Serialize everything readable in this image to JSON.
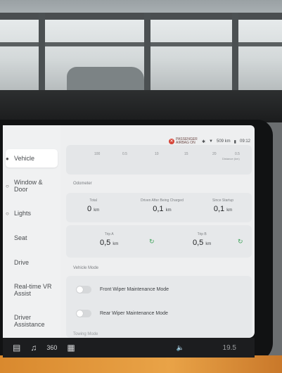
{
  "sidebar": {
    "items": [
      {
        "label": "Vehicle"
      },
      {
        "label": "Window & Door"
      },
      {
        "label": "Lights"
      },
      {
        "label": "Seat"
      },
      {
        "label": "Drive"
      },
      {
        "label": "Real-time VR Assist"
      },
      {
        "label": "Driver Assistance"
      }
    ]
  },
  "status": {
    "airbag_text": "PASSENGER AIRBAG ON",
    "range": "509 km",
    "time": "09:12"
  },
  "scale": {
    "ticks": [
      "100",
      "0.5",
      "10",
      "15",
      "20",
      "0.5"
    ],
    "caption": "Distance (km)"
  },
  "odometer": {
    "section_label": "Odometer",
    "total_label": "Total",
    "total_value": "0",
    "after_charge_label": "Driven After Being Charged",
    "after_charge_value": "0,1",
    "since_startup_label": "Since Startup",
    "since_startup_value": "0,1",
    "trip_a_label": "Trip A",
    "trip_a_value": "0,5",
    "trip_b_label": "Trip B",
    "trip_b_value": "0,5",
    "unit": "km"
  },
  "vehicle_mode": {
    "section_label": "Vehicle Mode",
    "front_wiper_label": "Front Wiper Maintenance Mode",
    "front_wiper_on": false,
    "rear_wiper_label": "Rear Wiper Maintenance Mode",
    "rear_wiper_on": false,
    "next_label": "Towing Mode"
  },
  "taskbar": {
    "climate_temp": "19.5"
  }
}
